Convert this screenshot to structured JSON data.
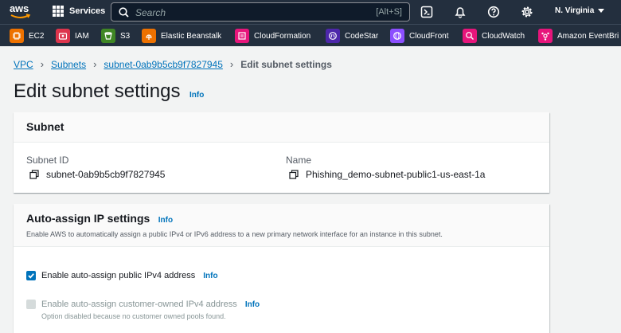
{
  "nav": {
    "logo_text": "aws",
    "services_label": "Services",
    "search_placeholder": "Search",
    "search_shortcut": "[Alt+S]",
    "region": "N. Virginia",
    "icons": [
      "cloudshell-icon",
      "notifications-icon",
      "help-icon",
      "settings-icon"
    ]
  },
  "favorites": [
    {
      "label": "EC2",
      "color": "#ed7100",
      "icon": "ec2-icon"
    },
    {
      "label": "IAM",
      "color": "#dd344c",
      "icon": "iam-icon"
    },
    {
      "label": "S3",
      "color": "#3f8624",
      "icon": "s3-icon"
    },
    {
      "label": "Elastic Beanstalk",
      "color": "#ed7100",
      "icon": "elastic-beanstalk-icon"
    },
    {
      "label": "CloudFormation",
      "color": "#e7157b",
      "icon": "cloudformation-icon"
    },
    {
      "label": "CodeStar",
      "color": "#4d27aa",
      "icon": "codestar-icon"
    },
    {
      "label": "CloudFront",
      "color": "#8c4fff",
      "icon": "cloudfront-icon"
    },
    {
      "label": "CloudWatch",
      "color": "#e7157b",
      "icon": "cloudwatch-icon"
    },
    {
      "label": "Amazon EventBri",
      "color": "#e7157b",
      "icon": "eventbridge-icon"
    }
  ],
  "breadcrumb": {
    "vpc": "VPC",
    "subnets": "Subnets",
    "subnet_id": "subnet-0ab9b5cb9f7827945",
    "current": "Edit subnet settings"
  },
  "page": {
    "title": "Edit subnet settings",
    "info": "Info"
  },
  "subnet_panel": {
    "heading": "Subnet",
    "id_label": "Subnet ID",
    "id_value": "subnet-0ab9b5cb9f7827945",
    "name_label": "Name",
    "name_value": "Phishing_demo-subnet-public1-us-east-1a"
  },
  "auto_assign": {
    "heading": "Auto-assign IP settings",
    "info": "Info",
    "description": "Enable AWS to automatically assign a public IPv4 or IPv6 address to a new primary network interface for an instance in this subnet.",
    "options": [
      {
        "label": "Enable auto-assign public IPv4 address",
        "info": "Info",
        "checked": true,
        "disabled": false
      },
      {
        "label": "Enable auto-assign customer-owned IPv4 address",
        "info": "Info",
        "checked": false,
        "disabled": true,
        "hint": "Option disabled because no customer owned pools found."
      }
    ]
  },
  "colors": {
    "nav_bg": "#232f3e",
    "link": "#0073bb",
    "page_bg": "#f2f3f3"
  }
}
